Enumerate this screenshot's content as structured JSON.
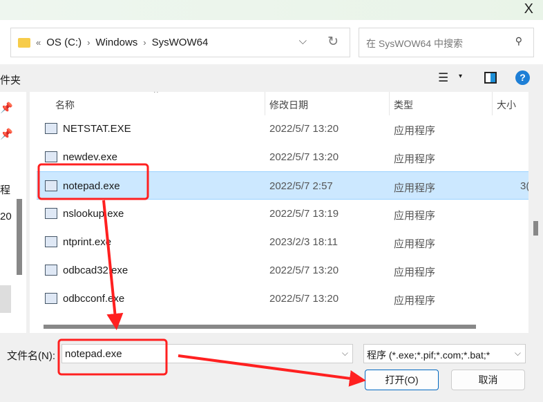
{
  "window": {
    "close": "X"
  },
  "address": {
    "crumbs": [
      "OS (C:)",
      "Windows",
      "SysWOW64"
    ],
    "prefix": "«"
  },
  "search": {
    "placeholder": "在 SysWOW64 中搜索"
  },
  "toolbar": {
    "left_text": "件夹",
    "help": "?",
    "view": "☰",
    "dropdown": "▾"
  },
  "sidebar": {
    "items": [
      "程",
      "20"
    ]
  },
  "columns": {
    "name": "名称",
    "date": "修改日期",
    "type": "类型",
    "size": "大小"
  },
  "files": [
    {
      "name": "NETSTAT.EXE",
      "date": "2022/5/7 13:20",
      "type": "应用程序",
      "size": ""
    },
    {
      "name": "newdev.exe",
      "date": "2022/5/7 13:20",
      "type": "应用程序",
      "size": ""
    },
    {
      "name": "notepad.exe",
      "date": "2022/5/7 2:57",
      "type": "应用程序",
      "size": "3("
    },
    {
      "name": "nslookup.exe",
      "date": "2022/5/7 13:19",
      "type": "应用程序",
      "size": ""
    },
    {
      "name": "ntprint.exe",
      "date": "2023/2/3 18:11",
      "type": "应用程序",
      "size": ""
    },
    {
      "name": "odbcad32.exe",
      "date": "2022/5/7 13:20",
      "type": "应用程序",
      "size": ""
    },
    {
      "name": "odbcconf.exe",
      "date": "2022/5/7 13:20",
      "type": "应用程序",
      "size": ""
    }
  ],
  "selected_index": 2,
  "footer": {
    "filename_label": "文件名(N):",
    "filename_value": "notepad.exe",
    "filetype": "程序 (*.exe;*.pif;*.com;*.bat;*",
    "open": "打开(O)",
    "cancel": "取消"
  },
  "annotation_color": "#ff2020"
}
